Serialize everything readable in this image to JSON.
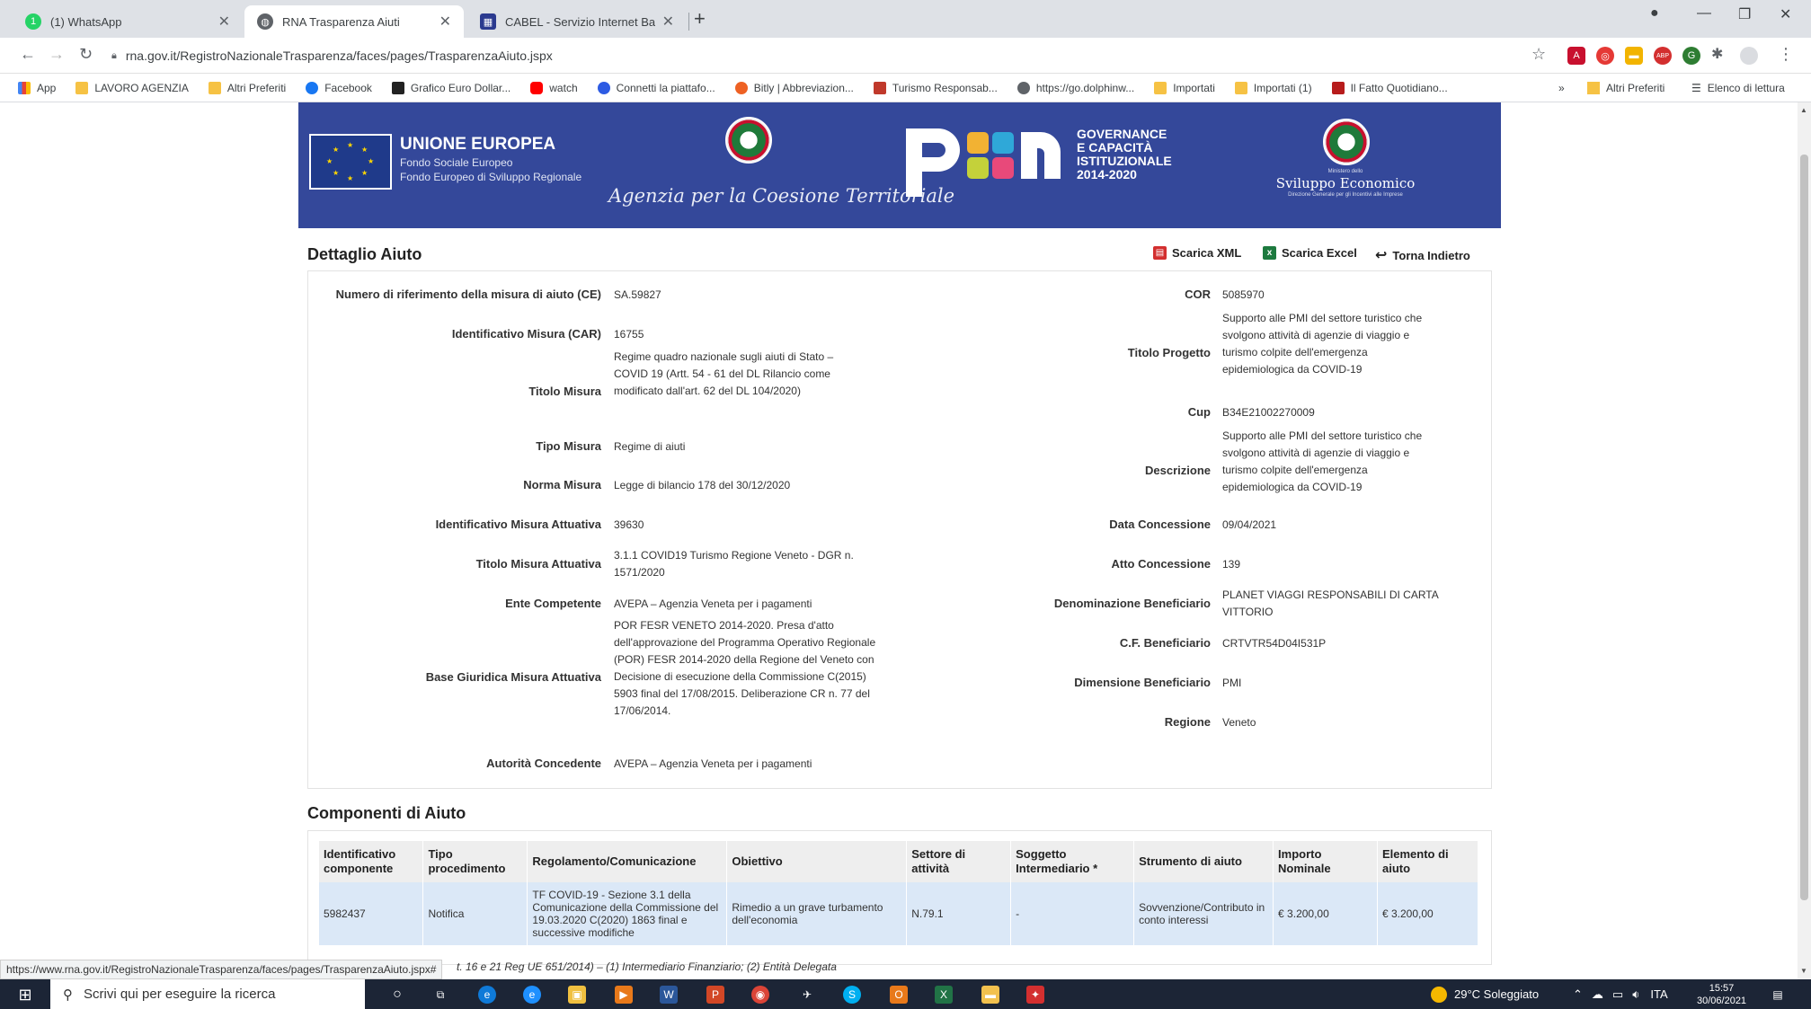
{
  "tabs": [
    {
      "title": "(1) WhatsApp",
      "active": false
    },
    {
      "title": "RNA Trasparenza Aiuti",
      "active": true
    },
    {
      "title": "CABEL - Servizio Internet Banking",
      "active": false
    }
  ],
  "addressbar": {
    "url": "rna.gov.it/RegistroNazionaleTrasparenza/faces/pages/TrasparenzaAiuto.jspx"
  },
  "bookmarks": {
    "items": [
      "App",
      "LAVORO AGENZIA",
      "Altri Preferiti",
      "Facebook",
      "Grafico Euro Dollar...",
      "watch",
      "Connetti la piattafo...",
      "Bitly | Abbreviazion...",
      "Turismo Responsab...",
      "https://go.dolphinw...",
      "Importati",
      "Importati (1)",
      "Il Fatto Quotidiano..."
    ],
    "overflow": "»",
    "right": [
      "Altri Preferiti",
      "Elenco di lettura"
    ]
  },
  "banner": {
    "eu_title": "UNIONE EUROPEA",
    "eu_sub1": "Fondo Sociale Europeo",
    "eu_sub2": "Fondo Europeo di Sviluppo Regionale",
    "agenzia": "Agenzia per la Coesione Territoriale",
    "pon_lines": [
      "GOVERNANCE",
      "E CAPACITÀ",
      "ISTITUZIONALE",
      "2014-2020"
    ],
    "ministero_small": "Ministero dello",
    "ministero": "Sviluppo Economico",
    "ministero_sub": "Direzione Generale per gli Incentivi alle Imprese"
  },
  "detail": {
    "title": "Dettaglio Aiuto",
    "actions": {
      "xml": "Scarica XML",
      "excel": "Scarica Excel",
      "back": "Torna Indietro"
    },
    "left": [
      {
        "label": "Numero di riferimento della misura di aiuto (CE)",
        "value": "SA.59827"
      },
      {
        "label": "Identificativo Misura (CAR)",
        "value": "16755"
      },
      {
        "label": "Titolo Misura",
        "value": "Regime quadro nazionale sugli aiuti di Stato – COVID 19 (Artt. 54 - 61 del DL Rilancio come modificato dall'art. 62 del DL 104/2020)"
      },
      {
        "label": "Tipo Misura",
        "value": "Regime di aiuti"
      },
      {
        "label": "Norma Misura",
        "value": "Legge di bilancio 178 del 30/12/2020"
      },
      {
        "label": "Identificativo Misura Attuativa",
        "value": "39630"
      },
      {
        "label": "Titolo Misura Attuativa",
        "value": "3.1.1 COVID19 Turismo Regione Veneto - DGR n. 1571/2020"
      },
      {
        "label": "Ente Competente",
        "value": "AVEPA – Agenzia Veneta per i pagamenti"
      },
      {
        "label": "Base Giuridica Misura Attuativa",
        "value": "POR FESR VENETO 2014-2020. Presa d'atto dell'approvazione del Programma Operativo Regionale (POR) FESR 2014-2020 della Regione del Veneto con Decisione di esecuzione della Commissione C(2015) 5903 final del 17/08/2015. Deliberazione CR n. 77 del 17/06/2014."
      },
      {
        "label": "Autorità Concedente",
        "value": "AVEPA – Agenzia Veneta per i pagamenti"
      }
    ],
    "right": [
      {
        "label": "COR",
        "value": "5085970"
      },
      {
        "label": "Titolo Progetto",
        "value": "Supporto alle PMI del settore turistico che svolgono attività di agenzie di viaggio e turismo colpite dell'emergenza epidemiologica da COVID-19"
      },
      {
        "label": "Cup",
        "value": "B34E21002270009"
      },
      {
        "label": "Descrizione",
        "value": "Supporto alle PMI del settore turistico che svolgono attività di agenzie di viaggio e turismo colpite dell'emergenza epidemiologica da COVID-19"
      },
      {
        "label": "Data Concessione",
        "value": "09/04/2021"
      },
      {
        "label": "Atto Concessione",
        "value": "139"
      },
      {
        "label": "Denominazione Beneficiario",
        "value": "PLANET VIAGGI RESPONSABILI DI CARTA VITTORIO"
      },
      {
        "label": "C.F. Beneficiario",
        "value": "CRTVTR54D04I531P"
      },
      {
        "label": "Dimensione Beneficiario",
        "value": "PMI"
      },
      {
        "label": "Regione",
        "value": "Veneto"
      }
    ]
  },
  "components": {
    "title": "Componenti di Aiuto",
    "headers": [
      "Identificativo componente",
      "Tipo procedimento",
      "Regolamento/Comunicazione",
      "Obiettivo",
      "Settore di attività",
      "Soggetto Intermediario *",
      "Strumento di aiuto",
      "Importo Nominale",
      "Elemento di aiuto"
    ],
    "rows": [
      [
        "5982437",
        "Notifica",
        "TF COVID-19 - Sezione 3.1 della Comunicazione della Commissione del 19.03.2020 C(2020) 1863 final e successive modifiche",
        "Rimedio a un grave turbamento dell'economia",
        "N.79.1",
        "-",
        "Sovvenzione/Contributo in conto interessi",
        "€ 3.200,00",
        "€ 3.200,00"
      ]
    ],
    "footnote": "t. 16 e 21 Reg UE 651/2014) – (1) Intermediario Finanziario; (2) Entità Delegata"
  },
  "statusbar": {
    "url": "https://www.rna.gov.it/RegistroNazionaleTrasparenza/faces/pages/TrasparenzaAiuto.jspx#"
  },
  "taskbar": {
    "search_placeholder": "Scrivi qui per eseguire la ricerca",
    "weather": "29°C Soleggiato",
    "lang": "ITA",
    "time": "15:57",
    "date": "30/06/2021"
  }
}
